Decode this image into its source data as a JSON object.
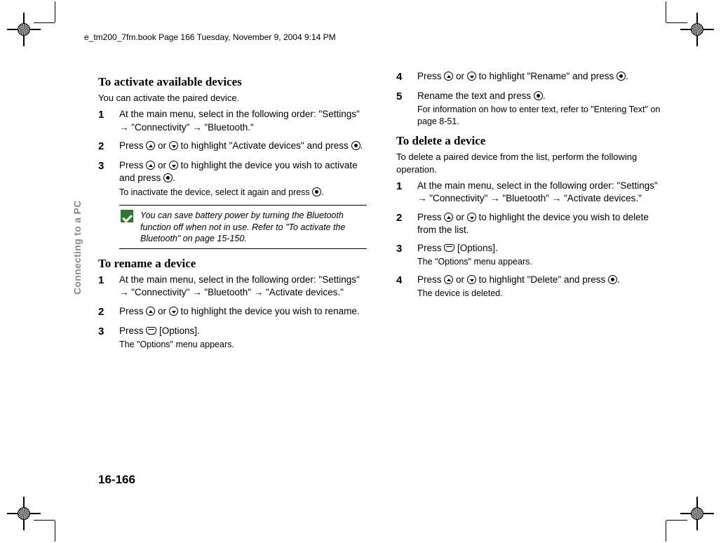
{
  "header": "e_tm200_7fm.book  Page 166  Tuesday, November 9, 2004  9:14 PM",
  "side_label": "Connecting to a PC",
  "page_number": "16-166",
  "sec_activate": {
    "title": "To activate available devices",
    "intro": "You can activate the paired device.",
    "steps": [
      {
        "num": "1",
        "text_a": "At the main menu, select in the following order: \"Settings\" ",
        "text_b": " \"Connectivity\" ",
        "text_c": " \"Bluetooth.\""
      },
      {
        "num": "2",
        "text_a": "Press ",
        "text_b": " or ",
        "text_c": " to highlight \"Activate devices\" and press ",
        "text_d": "."
      },
      {
        "num": "3",
        "text_a": "Press ",
        "text_b": " or ",
        "text_c": " to highlight the device you wish to activate and press ",
        "text_d": ".",
        "sub_a": "To inactivate the device, select it again and press ",
        "sub_b": "."
      }
    ],
    "tip": "You can save battery power by turning the Bluetooth function off when not in use. Refer to \"To activate the Bluetooth\" on page 15-150."
  },
  "sec_rename": {
    "title": "To rename a device",
    "steps": [
      {
        "num": "1",
        "text_a": "At the main menu, select in the following order: \"Settings\" ",
        "text_b": " \"Connectivity\" ",
        "text_c": " \"Bluetooth\" ",
        "text_d": " \"Activate devices.\""
      },
      {
        "num": "2",
        "text_a": "Press ",
        "text_b": " or ",
        "text_c": " to highlight the device you wish to rename."
      },
      {
        "num": "3",
        "text_a": "Press ",
        "text_b": " [Options].",
        "sub": "The \"Options\" menu appears."
      }
    ]
  },
  "sec_rename_cont": {
    "steps": [
      {
        "num": "4",
        "text_a": "Press ",
        "text_b": " or ",
        "text_c": " to highlight \"Rename\" and press ",
        "text_d": "."
      },
      {
        "num": "5",
        "text_a": "Rename the text and press ",
        "text_b": ".",
        "sub": "For information on how to enter text, refer to \"Entering Text\" on page 8-51."
      }
    ]
  },
  "sec_delete": {
    "title": "To delete a device",
    "intro": "To delete a paired device from the list, perform the following operation.",
    "steps": [
      {
        "num": "1",
        "text_a": "At the main menu, select in the following order: \"Settings\" ",
        "text_b": " \"Connectivity\" ",
        "text_c": " \"Bluetooth\" ",
        "text_d": " \"Activate devices.\""
      },
      {
        "num": "2",
        "text_a": "Press ",
        "text_b": " or ",
        "text_c": " to highlight the device you wish to delete from the list."
      },
      {
        "num": "3",
        "text_a": "Press ",
        "text_b": " [Options].",
        "sub": "The \"Options\" menu appears."
      },
      {
        "num": "4",
        "text_a": "Press ",
        "text_b": " or ",
        "text_c": " to highlight \"Delete\" and press ",
        "text_d": ".",
        "sub": "The device is deleted."
      }
    ]
  },
  "arrow": "→"
}
